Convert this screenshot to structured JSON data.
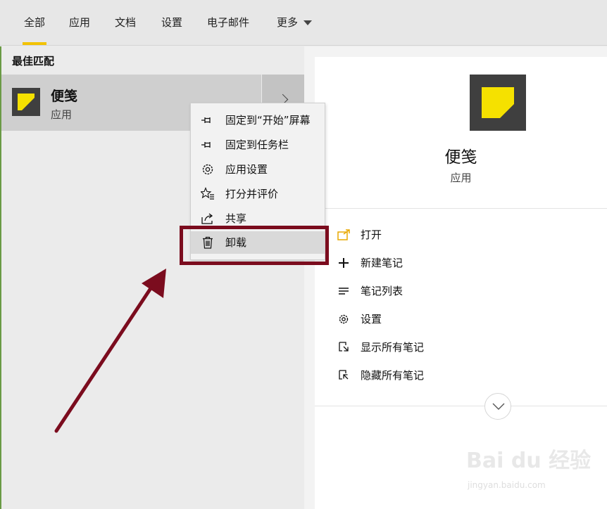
{
  "tabs": [
    {
      "label": "全部",
      "active": true
    },
    {
      "label": "应用",
      "active": false
    },
    {
      "label": "文档",
      "active": false
    },
    {
      "label": "设置",
      "active": false
    },
    {
      "label": "电子邮件",
      "active": false
    },
    {
      "label": "更多",
      "active": false
    }
  ],
  "best_match": {
    "section_title": "最佳匹配",
    "app_name": "便笺",
    "app_type": "应用"
  },
  "context_menu": {
    "items": [
      {
        "label": "固定到“开始”屏幕",
        "icon": "pin-icon"
      },
      {
        "label": "固定到任务栏",
        "icon": "pin-icon"
      },
      {
        "label": "应用设置",
        "icon": "gear-icon"
      },
      {
        "label": "打分并评价",
        "icon": "rate-review-icon"
      },
      {
        "label": "共享",
        "icon": "share-icon"
      },
      {
        "label": "卸载",
        "icon": "trash-icon",
        "highlighted": true
      }
    ]
  },
  "detail": {
    "app_name": "便笺",
    "app_type": "应用",
    "actions": [
      {
        "label": "打开",
        "icon": "open-icon"
      },
      {
        "label": "新建笔记",
        "icon": "plus-icon"
      },
      {
        "label": "笔记列表",
        "icon": "list-icon"
      },
      {
        "label": "设置",
        "icon": "gear-icon"
      },
      {
        "label": "显示所有笔记",
        "icon": "show-notes-icon"
      },
      {
        "label": "隐藏所有笔记",
        "icon": "hide-notes-icon"
      }
    ]
  },
  "watermark": {
    "brand": "Bai du 经验",
    "url": "jingyan.baidu.com"
  },
  "colors": {
    "accent": "#f2c200",
    "note_yellow": "#f5e100",
    "annotation": "#7b0c1e"
  }
}
